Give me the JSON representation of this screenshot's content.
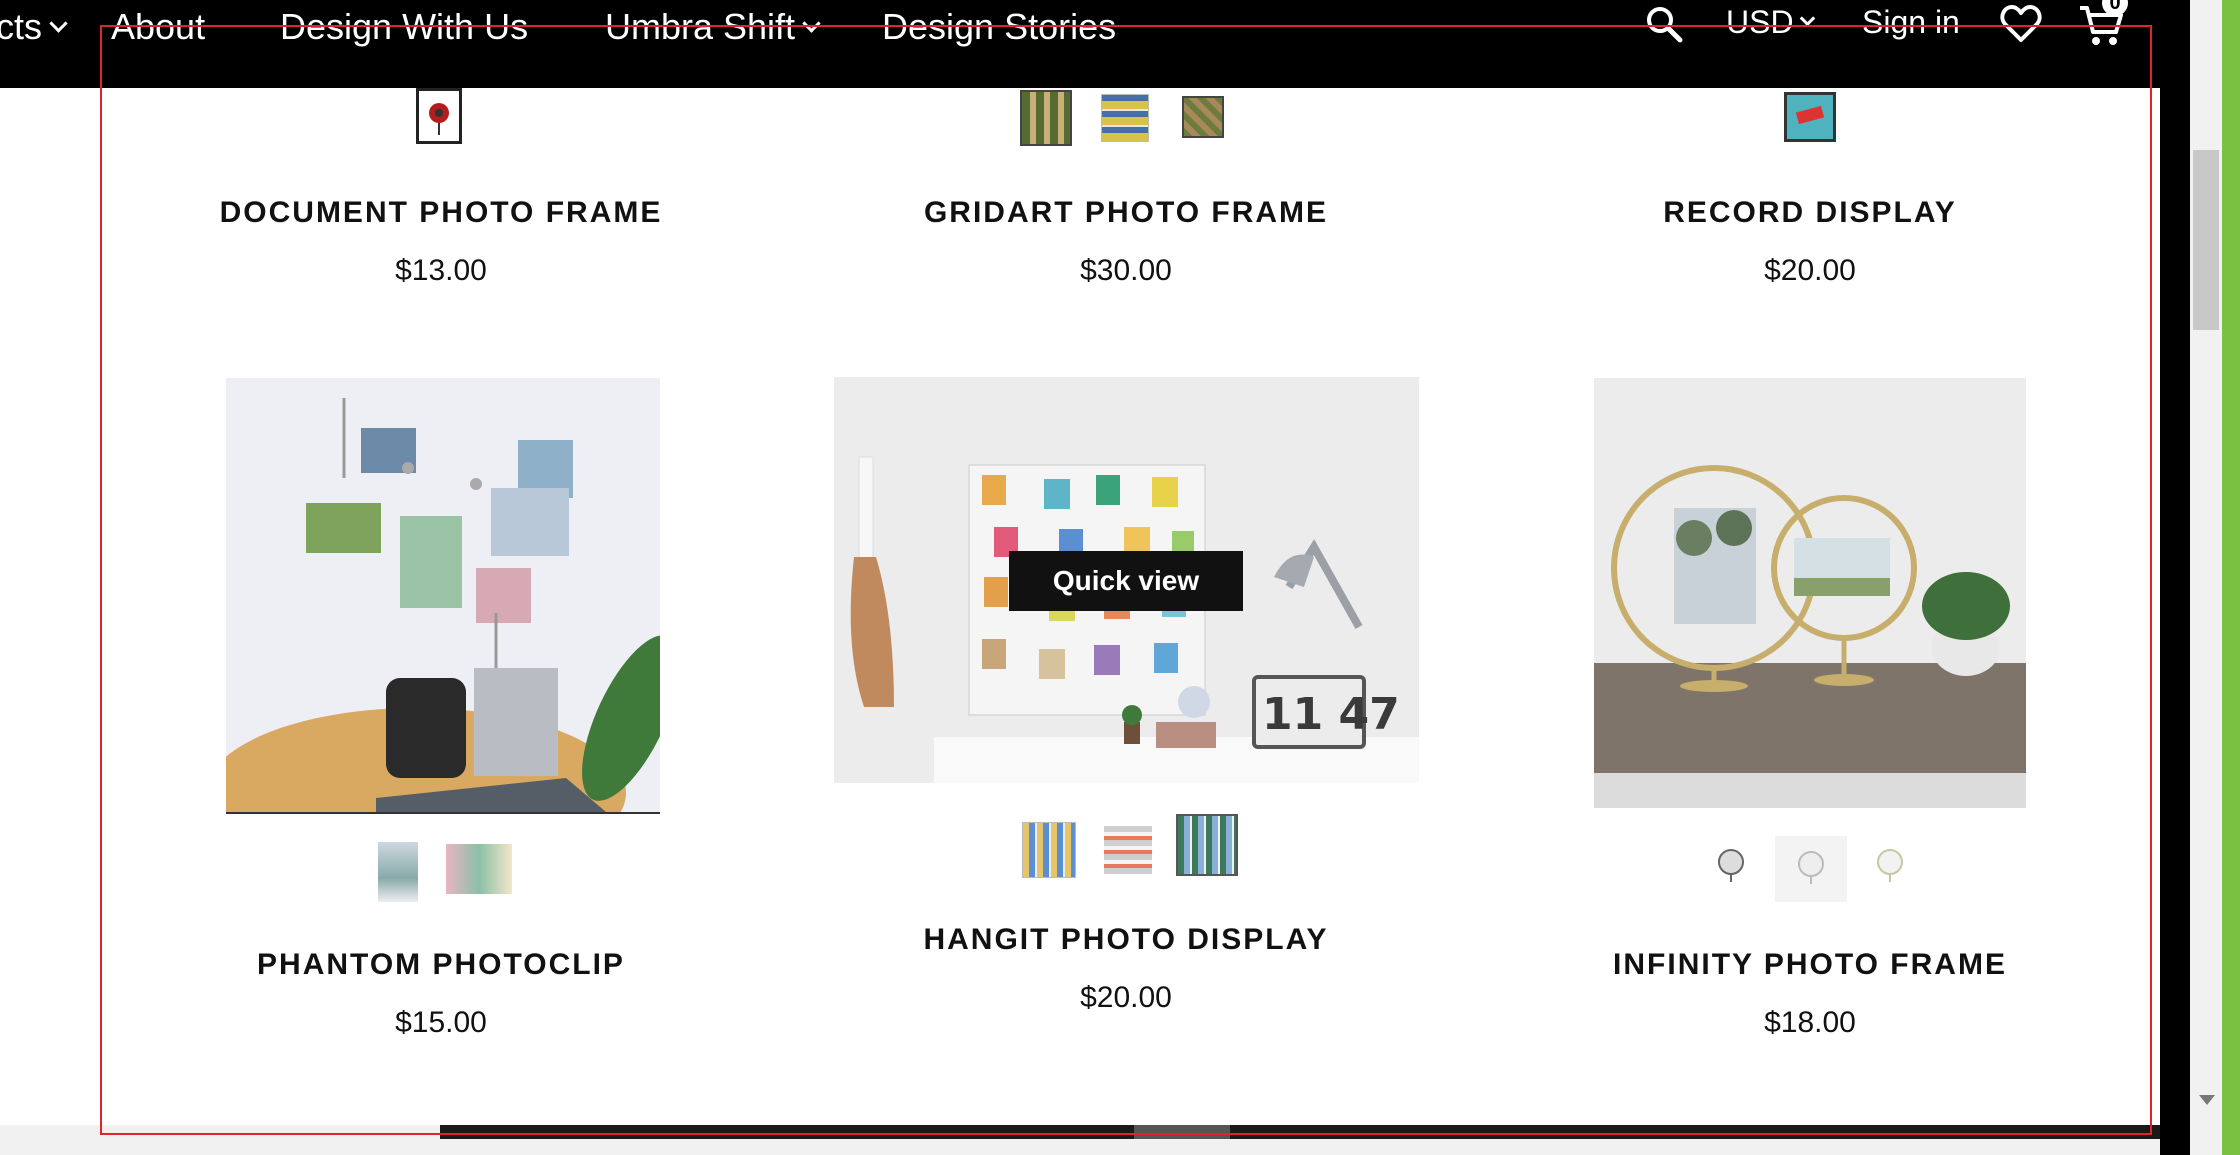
{
  "nav": {
    "items": [
      {
        "label": "cts"
      },
      {
        "label": "About"
      },
      {
        "label": "Design With Us"
      },
      {
        "label": "Umbra Shift"
      },
      {
        "label": "Design Stories"
      }
    ],
    "currency": "USD",
    "signin": "Sign in",
    "cart_count": "0",
    "icons": [
      "search-icon",
      "heart-icon",
      "cart-icon",
      "chevron-down-icon"
    ]
  },
  "products": [
    {
      "name": "DOCUMENT PHOTO FRAME",
      "price": "$13.00"
    },
    {
      "name": "GRIDART PHOTO FRAME",
      "price": "$30.00"
    },
    {
      "name": "RECORD DISPLAY",
      "price": "$20.00"
    },
    {
      "name": "PHANTOM PHOTOCLIP",
      "price": "$15.00"
    },
    {
      "name": "HANGIT PHOTO DISPLAY",
      "price": "$20.00"
    },
    {
      "name": "INFINITY PHOTO FRAME",
      "price": "$18.00"
    }
  ],
  "quick_view": "Quick view",
  "clock_display": "11 47",
  "colors": {
    "accent_green": "#7ac142",
    "annotation_red": "#e0242c",
    "nav_bg": "#000000"
  }
}
